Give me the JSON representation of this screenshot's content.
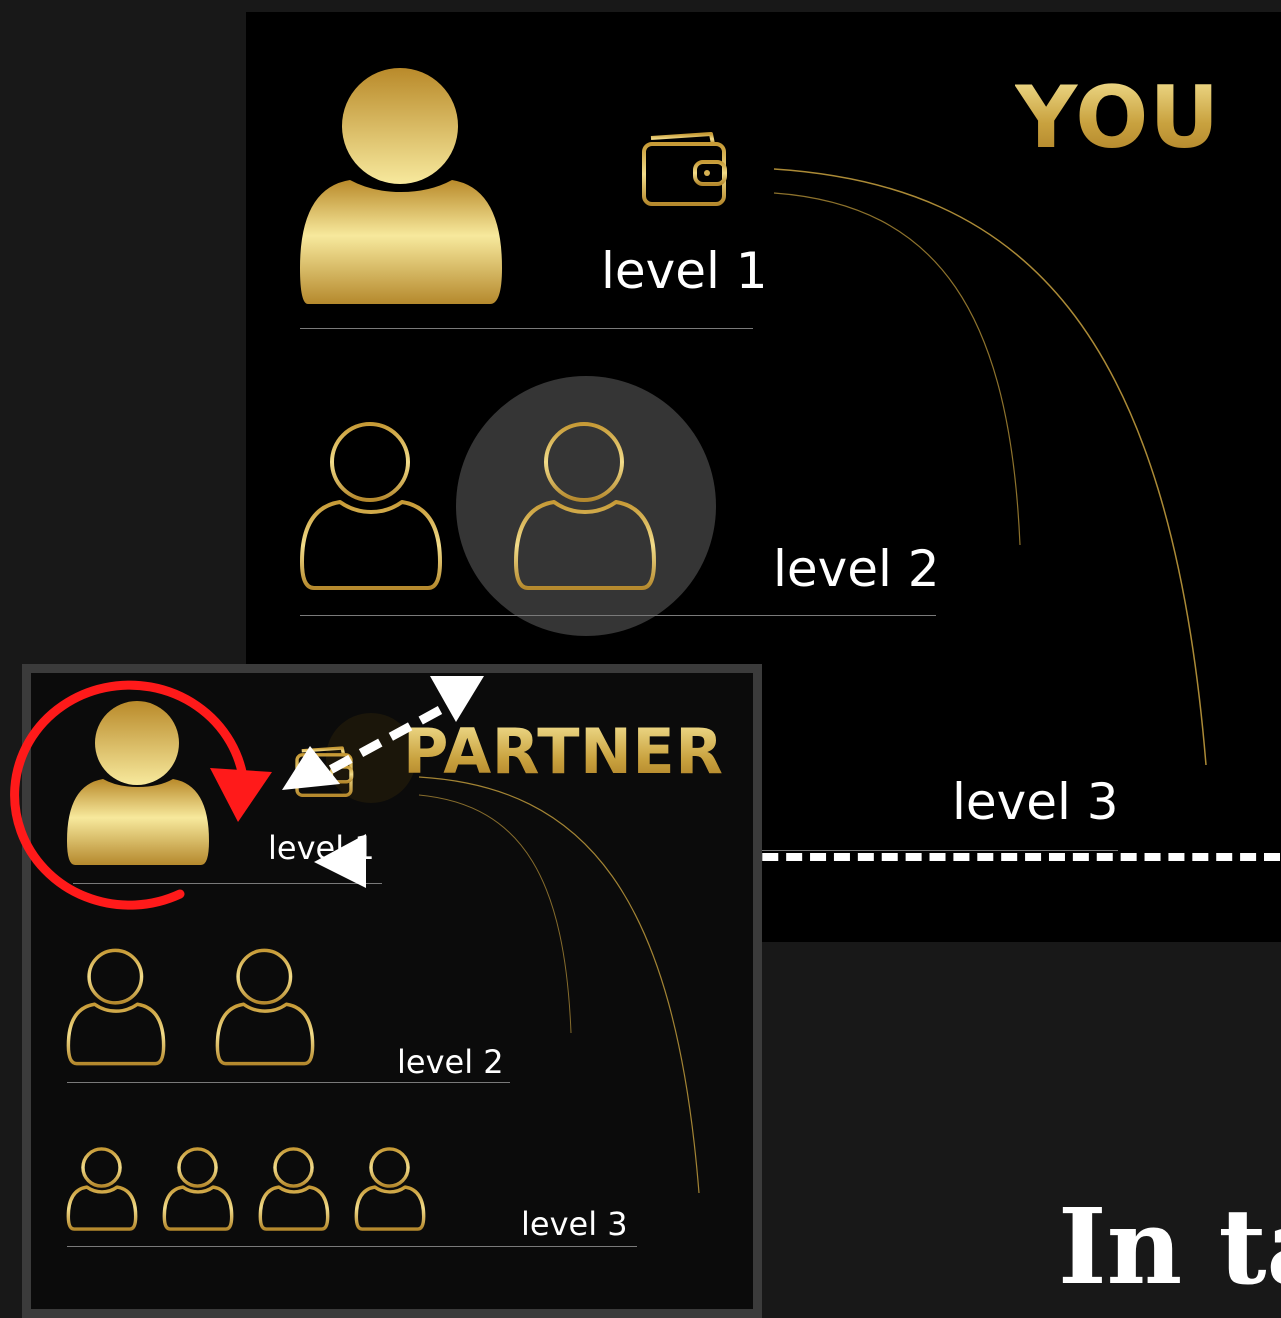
{
  "you_panel": {
    "title": "YOU",
    "level1_label": "level 1",
    "level2_label": "level 2",
    "level3_label": "level 3"
  },
  "partner_panel": {
    "title": "PARTNER",
    "level1_label": "level 1",
    "level2_label": "level 2",
    "level3_label": "level 3"
  },
  "bottom_heading": "In ta",
  "icons": [
    "user-filled-icon",
    "user-outline-icon",
    "wallet-icon",
    "refresh-arrow-icon"
  ],
  "colors": {
    "gold_light": "#f7e79a",
    "gold_dark": "#a97a22",
    "annotation_red": "#ff1a1a",
    "panel_bg": "#000000",
    "page_bg": "#181818"
  }
}
